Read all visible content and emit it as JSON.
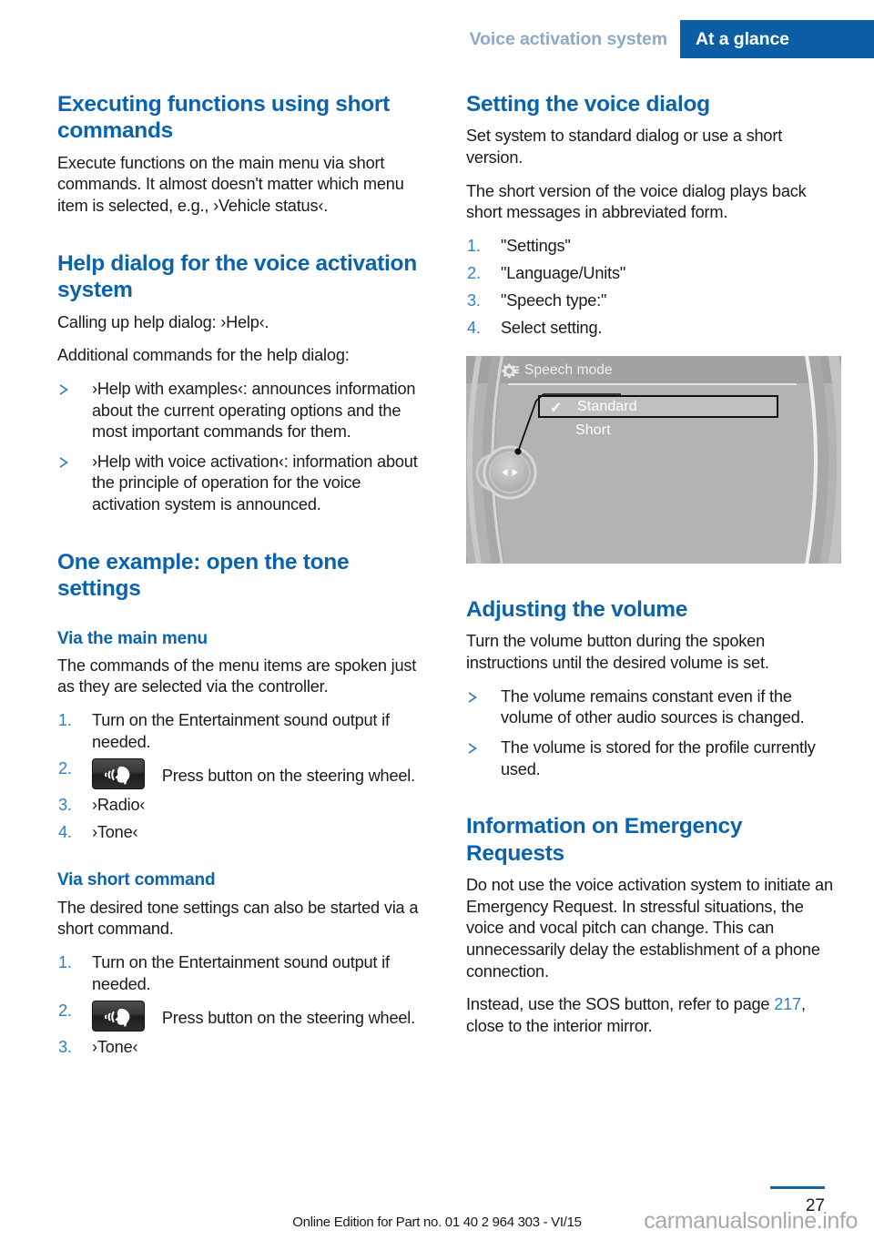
{
  "header": {
    "section_title": "Voice activation system",
    "chapter_title": "At a glance"
  },
  "left_column": {
    "heading_short_commands": "Executing functions using short commands",
    "para_short_commands": "Execute functions on the main menu via short commands. It almost doesn't matter which menu item is selected, e.g., ›Vehicle status‹.",
    "heading_help_dialog": "Help dialog for the voice activation system",
    "para_calling_help": "Calling up help dialog: ›Help‹.",
    "para_additional_commands": "Additional commands for the help dialog:",
    "help_bullets": [
      "›Help with examples‹: announces information about the current operating options and the most important commands for them.",
      "›Help with voice activation‹: information about the principle of operation for the voice activation system is announced."
    ],
    "heading_one_example": "One example: open the tone settings",
    "heading_via_main_menu": "Via the main menu",
    "para_via_main_menu": "The commands of the menu items are spoken just as they are selected via the controller.",
    "main_menu_steps": [
      {
        "num": "1.",
        "text": "Turn on the Entertainment sound output if needed.",
        "icon": null
      },
      {
        "num": "2.",
        "text": "Press button on the steering wheel.",
        "icon": "voice-button-icon"
      },
      {
        "num": "3.",
        "text": "›Radio‹",
        "icon": null
      },
      {
        "num": "4.",
        "text": "›Tone‹",
        "icon": null
      }
    ],
    "heading_via_short_command": "Via short command",
    "para_via_short_command": "The desired tone settings can also be started via a short command.",
    "short_command_steps": [
      {
        "num": "1.",
        "text": "Turn on the Entertainment sound output if needed.",
        "icon": null
      },
      {
        "num": "2.",
        "text": "Press button on the steering wheel.",
        "icon": "voice-button-icon"
      },
      {
        "num": "3.",
        "text": "›Tone‹",
        "icon": null
      }
    ]
  },
  "right_column": {
    "heading_setting_dialog": "Setting the voice dialog",
    "para_set_system": "Set system to standard dialog or use a short version.",
    "para_short_version": "The short version of the voice dialog plays back short messages in abbreviated form.",
    "dialog_steps": [
      {
        "num": "1.",
        "text": "\"Settings\""
      },
      {
        "num": "2.",
        "text": "\"Language/Units\""
      },
      {
        "num": "3.",
        "text": "\"Speech type:\""
      },
      {
        "num": "4.",
        "text": "Select setting."
      }
    ],
    "idrive_screen": {
      "title": "Speech mode",
      "title_icon": "gear-icon",
      "options": [
        {
          "label": "Standard",
          "selected": true,
          "checkmark": "✓"
        },
        {
          "label": "Short",
          "selected": false,
          "checkmark": ""
        }
      ],
      "controller_icon": "controller-knob-icon"
    },
    "heading_adjusting_volume": "Adjusting the volume",
    "para_turn_volume": "Turn the volume button during the spoken instructions until the desired volume is set.",
    "volume_bullets": [
      "The volume remains constant even if the volume of other audio sources is changed.",
      "The volume is stored for the profile currently used."
    ],
    "heading_emergency": "Information on Emergency Requests",
    "para_emergency": "Do not use the voice activation system to initiate an Emergency Request. In stressful situations, the voice and vocal pitch can change. This can unnecessarily delay the establishment of a phone connection.",
    "para_sos_prefix": "Instead, use the SOS button, refer to page ",
    "para_sos_xref": "217",
    "para_sos_suffix": ", close to the interior mirror."
  },
  "footer": {
    "edition": "Online Edition for Part no. 01 40 2 964 303 - VI/15",
    "page_number": "27",
    "watermark": "carmanualsonline.info"
  },
  "colors": {
    "brand_blue": "#0b5ea5",
    "heading_blue": "#0b63ad",
    "accent_blue": "#2f7fc4",
    "header_muted": "#8fa8c8"
  }
}
